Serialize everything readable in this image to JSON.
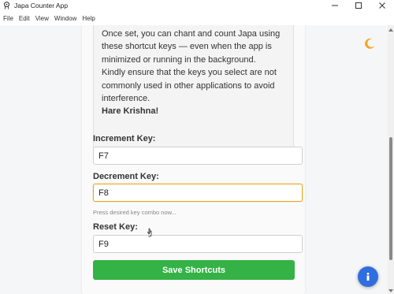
{
  "window": {
    "title": "Japa Counter App",
    "icons": [
      "app-logo-icon",
      "minimize-icon",
      "maximize-icon",
      "close-icon"
    ]
  },
  "menu": {
    "items": [
      "File",
      "Edit",
      "View",
      "Window",
      "Help"
    ]
  },
  "info": {
    "paragraph1": "Once set, you can chant and count Japa using these shortcut keys — even when the app is minimized or running in the background.",
    "paragraph2": "Kindly ensure that the keys you select are not commonly used in other applications to avoid interference.",
    "signoff": "Hare Krishna!"
  },
  "shortcuts": {
    "increment": {
      "label": "Increment Key:",
      "value": "F7"
    },
    "decrement": {
      "label": "Decrement Key:",
      "value": "F8",
      "hint": "Press desired key combo now..."
    },
    "reset": {
      "label": "Reset Key:",
      "value": "F9"
    }
  },
  "save_button": {
    "label": "Save Shortcuts"
  },
  "colors": {
    "accent_green": "#34b246",
    "focus_border": "#e6a820",
    "fab_blue": "#2f6ee0",
    "moon": "#f5a623"
  },
  "icons": {
    "theme_toggle": "moon-icon",
    "floating_action": "info-icon",
    "pointer": "cursor-icon"
  }
}
